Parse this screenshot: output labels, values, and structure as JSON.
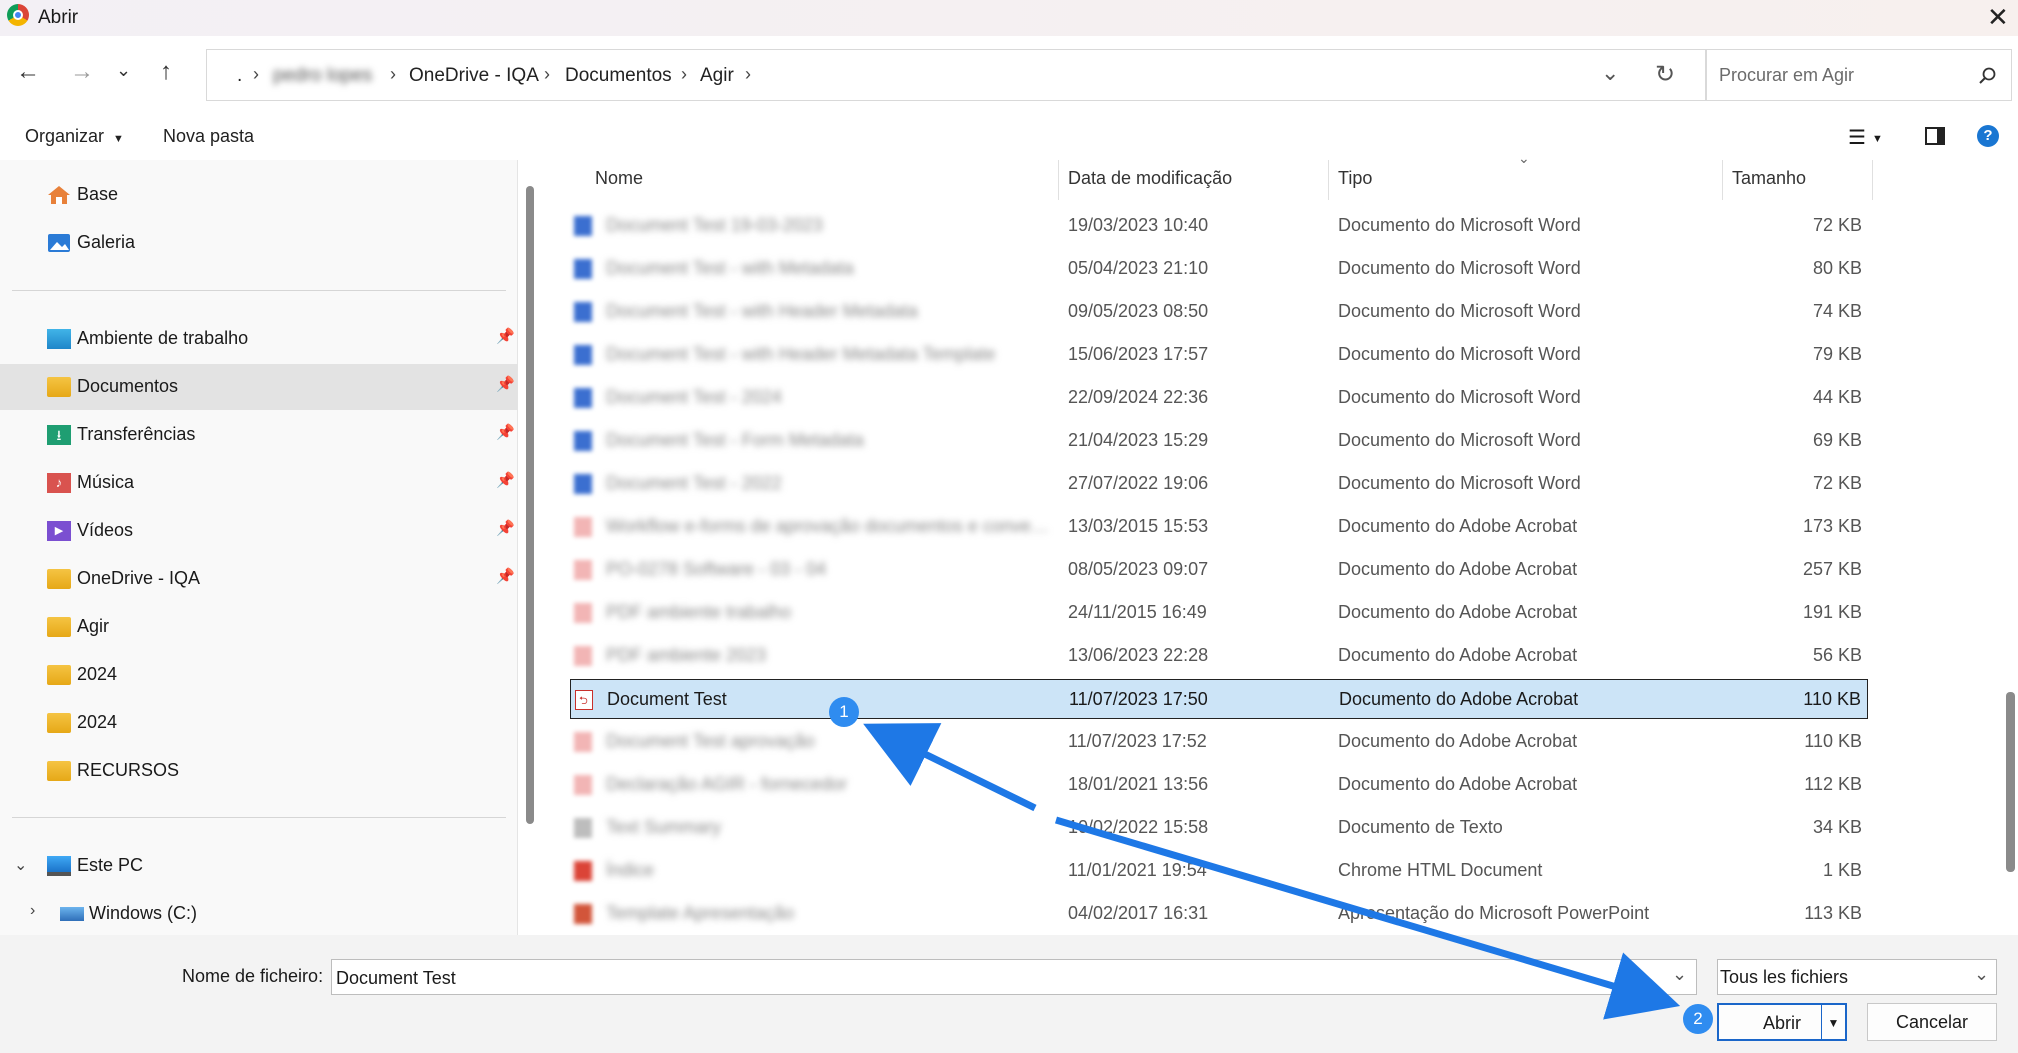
{
  "window": {
    "title": "Abrir"
  },
  "address": {
    "crumbs": [
      ".",
      "OneDrive - IQA",
      "Documentos",
      "Agir"
    ],
    "hidden_crumb": "pedro lopes"
  },
  "search": {
    "placeholder": "Procurar em Agir"
  },
  "toolbar": {
    "organize_label": "Organizar",
    "new_folder_label": "Nova pasta"
  },
  "nav": {
    "quick": [
      {
        "label": "Base"
      },
      {
        "label": "Galeria"
      }
    ],
    "pinned": [
      {
        "label": "Ambiente de trabalho"
      },
      {
        "label": "Documentos"
      },
      {
        "label": "Transferências"
      },
      {
        "label": "Música"
      },
      {
        "label": "Vídeos"
      },
      {
        "label": "OneDrive - IQA"
      },
      {
        "label": "Agir"
      },
      {
        "label": "2024"
      },
      {
        "label": "2024"
      },
      {
        "label": "RECURSOS"
      }
    ],
    "pc": {
      "label": "Este PC"
    },
    "drive": {
      "label": "Windows (C:)"
    }
  },
  "columns": {
    "name": "Nome",
    "date": "Data de modificação",
    "type": "Tipo",
    "size": "Tamanho"
  },
  "files": [
    {
      "name": "Document Test 19-03-2023",
      "date": "19/03/2023 10:40",
      "type": "Documento do Microsoft Word",
      "size": "72 KB",
      "kind": "word",
      "blurred": true
    },
    {
      "name": "Document Test - with Metadata",
      "date": "05/04/2023 21:10",
      "type": "Documento do Microsoft Word",
      "size": "80 KB",
      "kind": "word",
      "blurred": true
    },
    {
      "name": "Document Test - with Header Metadata",
      "date": "09/05/2023 08:50",
      "type": "Documento do Microsoft Word",
      "size": "74 KB",
      "kind": "word",
      "blurred": true
    },
    {
      "name": "Document Test - with Header Metadata Template",
      "date": "15/06/2023 17:57",
      "type": "Documento do Microsoft Word",
      "size": "79 KB",
      "kind": "word",
      "blurred": true
    },
    {
      "name": "Document Test - 2024",
      "date": "22/09/2024 22:36",
      "type": "Documento do Microsoft Word",
      "size": "44 KB",
      "kind": "word",
      "blurred": true
    },
    {
      "name": "Document Test - Form Metadata",
      "date": "21/04/2023 15:29",
      "type": "Documento do Microsoft Word",
      "size": "69 KB",
      "kind": "word",
      "blurred": true
    },
    {
      "name": "Document Test - 2022",
      "date": "27/07/2022 19:06",
      "type": "Documento do Microsoft Word",
      "size": "72 KB",
      "kind": "word",
      "blurred": true
    },
    {
      "name": "Workflow e-forms de aprovação documentos e conve…",
      "date": "13/03/2015 15:53",
      "type": "Documento do Adobe Acrobat",
      "size": "173 KB",
      "kind": "pdf",
      "blurred": true
    },
    {
      "name": "PO-0278 Software - 03 - 04",
      "date": "08/05/2023 09:07",
      "type": "Documento do Adobe Acrobat",
      "size": "257 KB",
      "kind": "pdf",
      "blurred": true
    },
    {
      "name": "PDF ambiente trabalho",
      "date": "24/11/2015 16:49",
      "type": "Documento do Adobe Acrobat",
      "size": "191 KB",
      "kind": "pdf",
      "blurred": true
    },
    {
      "name": "PDF ambiente 2023",
      "date": "13/06/2023 22:28",
      "type": "Documento do Adobe Acrobat",
      "size": "56 KB",
      "kind": "pdf",
      "blurred": true
    },
    {
      "name": "Document Test",
      "date": "11/07/2023 17:50",
      "type": "Documento do Adobe Acrobat",
      "size": "110 KB",
      "kind": "pdf",
      "blurred": false,
      "selected": true
    },
    {
      "name": "Document Test aprovação",
      "date": "11/07/2023 17:52",
      "type": "Documento do Adobe Acrobat",
      "size": "110 KB",
      "kind": "pdf",
      "blurred": true
    },
    {
      "name": "Declaração AGIR - fornecedor",
      "date": "18/01/2021 13:56",
      "type": "Documento do Adobe Acrobat",
      "size": "112 KB",
      "kind": "pdf",
      "blurred": true
    },
    {
      "name": "Text Summary",
      "date": "10/02/2022 15:58",
      "type": "Documento de Texto",
      "size": "34 KB",
      "kind": "txt",
      "blurred": true
    },
    {
      "name": "Índice",
      "date": "11/01/2021 19:54",
      "type": "Chrome HTML Document",
      "size": "1 KB",
      "kind": "html",
      "blurred": true
    },
    {
      "name": "Template Apresentação",
      "date": "04/02/2017 16:31",
      "type": "Apresentação do Microsoft PowerPoint",
      "size": "113 KB",
      "kind": "ppt",
      "blurred": true
    }
  ],
  "bottom": {
    "filename_label": "Nome de ficheiro:",
    "filename_value": "Document Test",
    "filter_value": "Tous les fichiers",
    "open_label": "Abrir",
    "cancel_label": "Cancelar"
  },
  "annotations": [
    {
      "label": "1"
    },
    {
      "label": "2"
    }
  ],
  "colors": {
    "accent": "#2f8cf0",
    "selection": "#cce4f7",
    "arrow": "#1e78e6"
  },
  "icons": [
    "chrome-icon",
    "back-arrow-icon",
    "forward-arrow-icon",
    "chevron-down-icon",
    "up-arrow-icon",
    "refresh-icon",
    "search-icon",
    "view-list-icon",
    "preview-pane-icon",
    "help-icon",
    "home-icon",
    "gallery-icon",
    "folder-icon",
    "pin-icon",
    "pc-icon",
    "drive-icon"
  ]
}
